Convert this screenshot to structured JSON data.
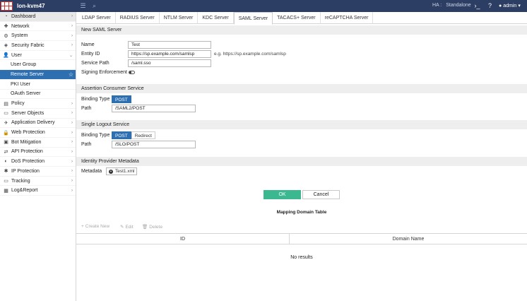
{
  "topbar": {
    "hostname": "lon-kvm47",
    "ha_label": "HA :",
    "ha_value": "Standalone",
    "user": "admin"
  },
  "sidebar": {
    "items": [
      {
        "label": "Dashboard",
        "icon": "dashboard-icon"
      },
      {
        "label": "Network",
        "icon": "network-icon"
      },
      {
        "label": "System",
        "icon": "gear-icon"
      },
      {
        "label": "Security Fabric",
        "icon": "shield-icon"
      },
      {
        "label": "User",
        "icon": "user-icon"
      },
      {
        "label": "User Group"
      },
      {
        "label": "Remote Server"
      },
      {
        "label": "PKI User"
      },
      {
        "label": "OAuth Server"
      },
      {
        "label": "Policy",
        "icon": "policy-icon"
      },
      {
        "label": "Server Objects",
        "icon": "server-icon"
      },
      {
        "label": "Application Delivery",
        "icon": "delivery-icon"
      },
      {
        "label": "Web Protection",
        "icon": "lock-icon"
      },
      {
        "label": "Bot Mitigation",
        "icon": "bot-icon"
      },
      {
        "label": "API Protection",
        "icon": "api-icon"
      },
      {
        "label": "DoS Protection",
        "icon": "dos-icon"
      },
      {
        "label": "IP Protection",
        "icon": "ip-icon"
      },
      {
        "label": "Tracking",
        "icon": "tracking-icon"
      },
      {
        "label": "Log&Report",
        "icon": "chart-icon"
      }
    ]
  },
  "tabs": [
    "LDAP Server",
    "RADIUS Server",
    "NTLM Server",
    "KDC Server",
    "SAML Server",
    "TACACS+ Server",
    "reCAPTCHA Server"
  ],
  "form": {
    "section_title": "New SAML Server",
    "name_label": "Name",
    "name_value": "Test",
    "entity_label": "Entity ID",
    "entity_value": "https://sp.example.com/samlsp",
    "entity_hint": "e.g. https://sp.example.com/samlsp",
    "service_path_label": "Service Path",
    "service_path_value": "/saml.sso",
    "signing_label": "Signing Enforcement",
    "acs_title": "Assertion Consumer Service",
    "acs_binding_label": "Binding Type",
    "acs_binding_option": "POST",
    "acs_path_label": "Path",
    "acs_path_value": "/SAML2/POST",
    "slo_title": "Single Logout Service",
    "slo_binding_label": "Binding Type",
    "slo_binding_post": "POST",
    "slo_binding_redirect": "Redirect",
    "slo_path_label": "Path",
    "slo_path_value": "/SLO/POST",
    "idp_title": "Identity Provider Metadata",
    "metadata_label": "Metadata",
    "metadata_file": "Test1.xml",
    "ok_label": "OK",
    "cancel_label": "Cancel"
  },
  "mapping": {
    "title": "Mapping Domain Table",
    "create_label": "Create New",
    "edit_label": "Edit",
    "delete_label": "Delete",
    "columns": [
      "ID",
      "Domain Name"
    ],
    "empty_text": "No results"
  },
  "colors": {
    "topbar": "#2c3e63",
    "accent": "#2d6fb0",
    "ok": "#3cb890"
  }
}
